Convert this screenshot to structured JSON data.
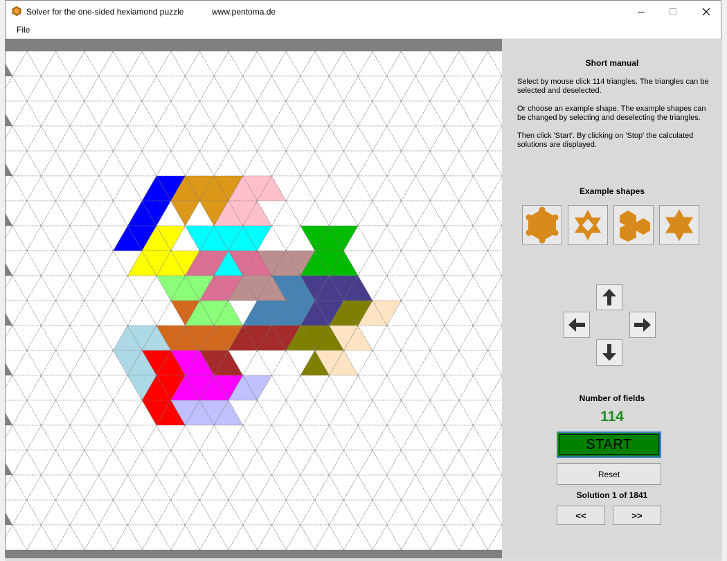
{
  "window": {
    "title": "Solver for the one-sided hexiamond puzzle",
    "url": "www.pentoma.de"
  },
  "menu": {
    "file_label": "File"
  },
  "manual": {
    "heading": "Short manual",
    "paragraph_1": "Select by mouse click 114 triangles. The triangles can be selected and deselected.",
    "paragraph_2": "Or choose an example shape. The example shapes can be changed by selecting and deselecting the triangles.",
    "paragraph_3": "Then click 'Start'. By clicking on 'Stop' the calculated solutions are displayed."
  },
  "example_shapes": {
    "heading": "Example shapes",
    "items": [
      "hexagon-shape-icon",
      "star-ring-shape-icon",
      "hook-shape-icon",
      "hexagram-shape-icon"
    ]
  },
  "arrows": [
    "arrow-up-icon",
    "arrow-left-icon",
    "arrow-right-icon",
    "arrow-down-icon"
  ],
  "fields": {
    "label": "Number of fields",
    "count": "114"
  },
  "controls": {
    "start_label": "START",
    "reset_label": "Reset",
    "prev_label": "<<",
    "next_label": ">>"
  },
  "solution": {
    "text": "Solution 1 of 1841",
    "current": 1,
    "total": 1841
  },
  "colors": {
    "accent_green": "#008000",
    "count_green": "#1e8c1e",
    "shape_orange": "#d98a1c",
    "board_background": "#808080"
  }
}
